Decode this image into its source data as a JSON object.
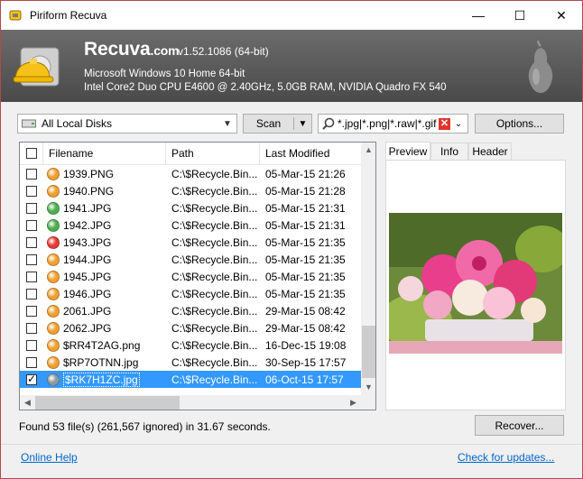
{
  "window": {
    "title": "Piriform Recuva",
    "minimize": "—",
    "maximize": "☐",
    "close": "✕"
  },
  "header": {
    "brand": "Recuva",
    "brand_suffix": ".com",
    "version": "v1.52.1086 (64-bit)",
    "os": "Microsoft Windows 10 Home 64-bit",
    "hardware": "Intel Core2 Duo CPU E4600 @ 2.40GHz, 5.0GB RAM, NVIDIA Quadro FX 540"
  },
  "toolbar": {
    "drive": "All Local Disks",
    "scan_label": "Scan",
    "filter": "*.jpg|*.png|*.raw|*.gif",
    "options_label": "Options..."
  },
  "columns": [
    "Filename",
    "Path",
    "Last Modified"
  ],
  "files": [
    {
      "name": "1939.PNG",
      "path": "C:\\$Recycle.Bin...",
      "modified": "05-Mar-15 21:26",
      "state": "orange",
      "checked": false,
      "selected": false
    },
    {
      "name": "1940.PNG",
      "path": "C:\\$Recycle.Bin...",
      "modified": "05-Mar-15 21:28",
      "state": "orange",
      "checked": false,
      "selected": false
    },
    {
      "name": "1941.JPG",
      "path": "C:\\$Recycle.Bin...",
      "modified": "05-Mar-15 21:31",
      "state": "green",
      "checked": false,
      "selected": false
    },
    {
      "name": "1942.JPG",
      "path": "C:\\$Recycle.Bin...",
      "modified": "05-Mar-15 21:31",
      "state": "green",
      "checked": false,
      "selected": false
    },
    {
      "name": "1943.JPG",
      "path": "C:\\$Recycle.Bin...",
      "modified": "05-Mar-15 21:35",
      "state": "red",
      "checked": false,
      "selected": false
    },
    {
      "name": "1944.JPG",
      "path": "C:\\$Recycle.Bin...",
      "modified": "05-Mar-15 21:35",
      "state": "orange",
      "checked": false,
      "selected": false
    },
    {
      "name": "1945.JPG",
      "path": "C:\\$Recycle.Bin...",
      "modified": "05-Mar-15 21:35",
      "state": "orange",
      "checked": false,
      "selected": false
    },
    {
      "name": "1946.JPG",
      "path": "C:\\$Recycle.Bin...",
      "modified": "05-Mar-15 21:35",
      "state": "orange",
      "checked": false,
      "selected": false
    },
    {
      "name": "2061.JPG",
      "path": "C:\\$Recycle.Bin...",
      "modified": "29-Mar-15 08:42",
      "state": "orange",
      "checked": false,
      "selected": false
    },
    {
      "name": "2062.JPG",
      "path": "C:\\$Recycle.Bin...",
      "modified": "29-Mar-15 08:42",
      "state": "orange",
      "checked": false,
      "selected": false
    },
    {
      "name": "$RR4T2AG.png",
      "path": "C:\\$Recycle.Bin...",
      "modified": "16-Dec-15 19:08",
      "state": "orange",
      "checked": false,
      "selected": false
    },
    {
      "name": "$RP7OTNN.jpg",
      "path": "C:\\$Recycle.Bin...",
      "modified": "30-Sep-15 17:57",
      "state": "orange",
      "checked": false,
      "selected": false
    },
    {
      "name": "$RK7H1ZC.jpg",
      "path": "C:\\$Recycle.Bin...",
      "modified": "06-Oct-15 17:57",
      "state": "gray",
      "checked": true,
      "selected": true
    }
  ],
  "state_colors": {
    "orange": "#f0a030",
    "green": "#4caf50",
    "red": "#e53935",
    "gray": "#8a9aa0"
  },
  "preview_tabs": [
    "Preview",
    "Info",
    "Header"
  ],
  "status": "Found 53 file(s) (261,567 ignored) in 31.67 seconds.",
  "recover_label": "Recover...",
  "footer": {
    "help_link": "Online Help",
    "updates_link": "Check for updates..."
  }
}
